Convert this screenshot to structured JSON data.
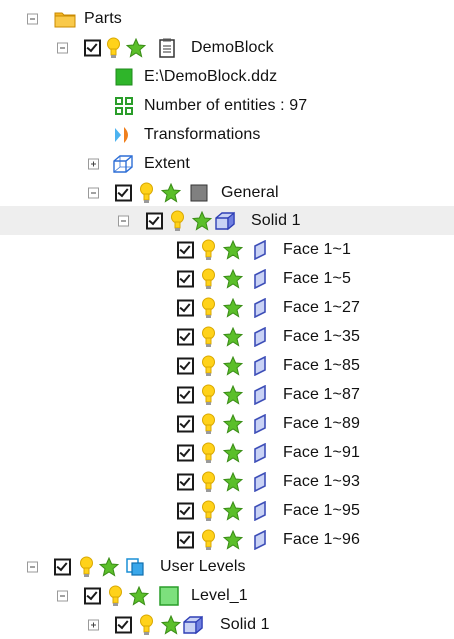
{
  "tree": {
    "parts": {
      "label": "Parts",
      "icon": "folder-icon"
    },
    "demoblock": {
      "label": "DemoBlock",
      "icon": "document-icon"
    },
    "file_path": {
      "label": "E:\\DemoBlock.ddz",
      "icon": "green-square-icon"
    },
    "entities": {
      "label": "Number of entities : 97",
      "icon": "grid-icon"
    },
    "transformations": {
      "label": "Transformations",
      "icon": "transform-icon"
    },
    "extent": {
      "label": "Extent",
      "icon": "wire-cube-icon"
    },
    "general": {
      "label": "General",
      "icon": "gray-square-icon"
    },
    "solid": {
      "label": "Solid 1",
      "icon": "solid-cube-icon"
    },
    "faces": [
      {
        "label": "Face 1~1"
      },
      {
        "label": "Face 1~5"
      },
      {
        "label": "Face 1~27"
      },
      {
        "label": "Face 1~35"
      },
      {
        "label": "Face 1~85"
      },
      {
        "label": "Face 1~87"
      },
      {
        "label": "Face 1~89"
      },
      {
        "label": "Face 1~91"
      },
      {
        "label": "Face 1~93"
      },
      {
        "label": "Face 1~95"
      },
      {
        "label": "Face 1~96"
      }
    ],
    "user_levels": {
      "label": "User Levels",
      "icon": "levels-icon"
    },
    "level1": {
      "label": "Level_1",
      "icon": "green-level-icon"
    },
    "level_solid": {
      "label": "Solid 1",
      "icon": "solid-cube-icon"
    }
  },
  "colors": {
    "selected_row": "#eeeeee",
    "bulb": "#ffd21a",
    "star": "#5bbf2a",
    "face": "#6f86c9"
  }
}
